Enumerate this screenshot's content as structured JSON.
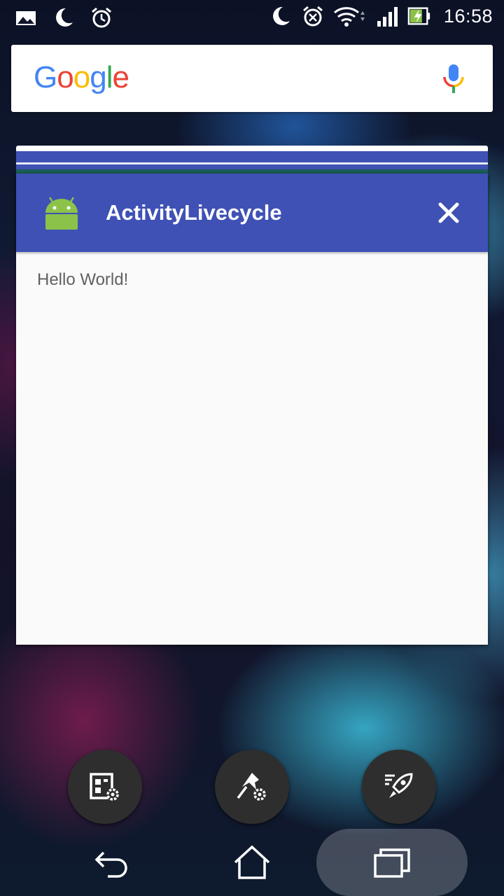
{
  "status_bar": {
    "time": "16:58",
    "left_icons": [
      "image-notification-icon",
      "moon-icon",
      "alarm-icon"
    ],
    "right_icons": [
      "moon-icon",
      "alarm-icon",
      "wifi-icon",
      "signal-icon",
      "battery-charging-icon"
    ]
  },
  "search": {
    "logo": "Google",
    "logo_colors": [
      "#4285F4",
      "#EA4335",
      "#FBBC05",
      "#4285F4",
      "#34A853",
      "#EA4335"
    ],
    "mic_icon": "mic-icon"
  },
  "task": {
    "app_title": "ActivityLivecycle",
    "app_icon": "android-icon",
    "content_text": "Hello World!",
    "header_color": "#3f51b5"
  },
  "actions": [
    {
      "name": "widgets-settings-button",
      "icon": "widget-gear-icon"
    },
    {
      "name": "pin-settings-button",
      "icon": "pin-gear-icon"
    },
    {
      "name": "boost-button",
      "icon": "rocket-icon"
    }
  ],
  "nav": {
    "back": "back-icon",
    "home": "home-icon",
    "recents": "recents-icon"
  }
}
